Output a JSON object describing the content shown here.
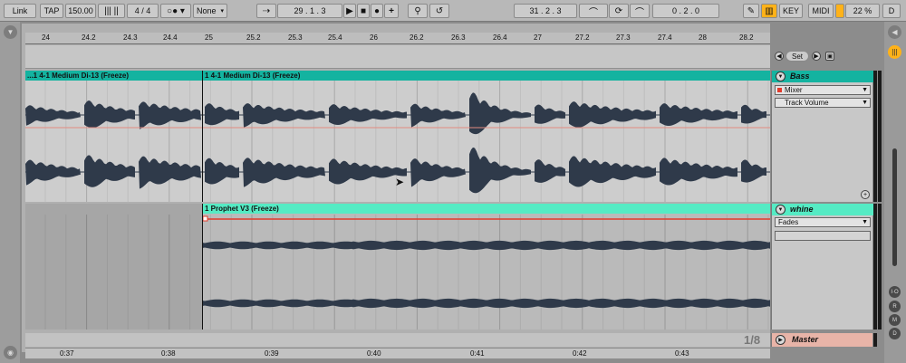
{
  "transport": {
    "link": "Link",
    "tap": "TAP",
    "tempo": "150.00",
    "signature": "4 / 4",
    "quantization": "None",
    "position": "29 .  1 .  3",
    "loop_start": "31 .  2 .  3",
    "loop_length": "0 .  2 .  0",
    "key_label": "KEY",
    "midi_label": "MIDI",
    "cpu": "22 %",
    "d_label": "D"
  },
  "ruler": {
    "bars": [
      "24",
      "24.2",
      "24.3",
      "24.4",
      "25",
      "25.2",
      "25.3",
      "25.4",
      "26",
      "26.2",
      "26.3",
      "26.4",
      "27",
      "27.2",
      "27.3",
      "27.4",
      "28",
      "28.2"
    ]
  },
  "set_label": "Set",
  "tracks": [
    {
      "name": "Bass",
      "clip_left": "...1 4-1 Medium Di-13 (Freeze)",
      "clip_main": "1 4-1 Medium Di-13 (Freeze)",
      "device": "Mixer",
      "parameter": "Track Volume",
      "color": "#14b3a0"
    },
    {
      "name": "whine",
      "clip_main": "1 Prophet V3 (Freeze)",
      "device": "Fades",
      "color": "#55ebc4"
    }
  ],
  "master": {
    "name": "Master",
    "page": "1/8",
    "color": "#e8b4a8"
  },
  "time_ruler": [
    "0:37",
    "0:38",
    "0:39",
    "0:40",
    "0:41",
    "0:42",
    "0:43"
  ],
  "colors": {
    "accent": "#ffb219",
    "automation": "#e23a2a",
    "waveform": "#2f3a4a"
  },
  "right_buttons": [
    "I·O",
    "R",
    "M",
    "D"
  ]
}
